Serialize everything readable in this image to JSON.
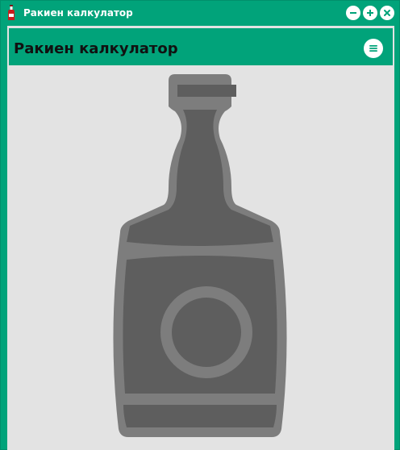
{
  "window": {
    "title": "Ракиен калкулатор",
    "controls": [
      "minimize-icon",
      "maximize-icon",
      "close-icon"
    ]
  },
  "header": {
    "title": "Ракиен калкулатор",
    "menu_icon": "menu-icon"
  },
  "main": {
    "image_icon": "bottle-icon"
  },
  "colors": {
    "accent": "#01a37a",
    "background": "#e3e3e3",
    "bottle_fill": "#5e5e5e",
    "bottle_outline": "#7d7d7d",
    "text": "#111111"
  }
}
